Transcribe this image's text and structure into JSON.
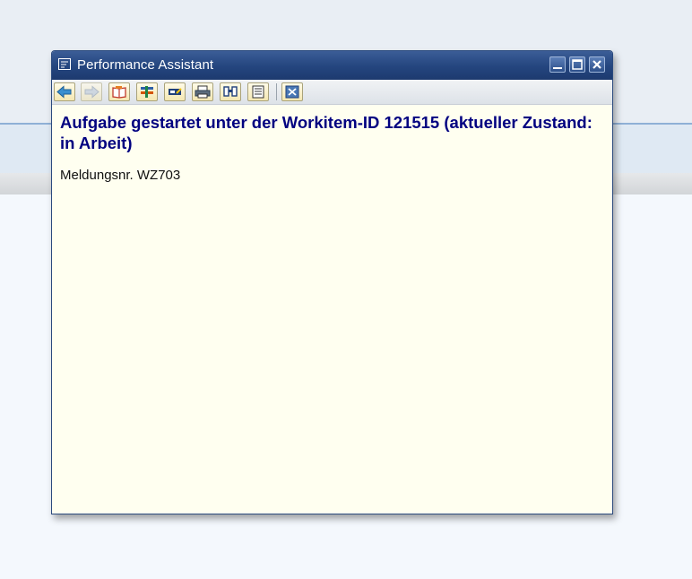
{
  "window": {
    "title": "Performance Assistant"
  },
  "toolbar": {
    "buttons": [
      {
        "name": "back-button",
        "icon": "arrow-left-icon"
      },
      {
        "name": "forward-button",
        "icon": "arrow-right-icon"
      },
      {
        "name": "book-button",
        "icon": "book-icon"
      },
      {
        "name": "technical-info-button",
        "icon": "tools-icon"
      },
      {
        "name": "edit-button",
        "icon": "edit-icon"
      },
      {
        "name": "print-button",
        "icon": "printer-icon"
      },
      {
        "name": "find-button",
        "icon": "binoculars-icon"
      },
      {
        "name": "document-button",
        "icon": "document-icon"
      },
      {
        "name": "close-help-button",
        "icon": "close-icon"
      }
    ]
  },
  "content": {
    "headline": "Aufgabe gestartet unter der Workitem-ID 121515 (aktueller Zustand: in Arbeit)",
    "message": "Meldungsnr. WZ703"
  },
  "colors": {
    "titlebar": "#24457e",
    "content_background": "#fffff0",
    "headline": "#000080"
  }
}
